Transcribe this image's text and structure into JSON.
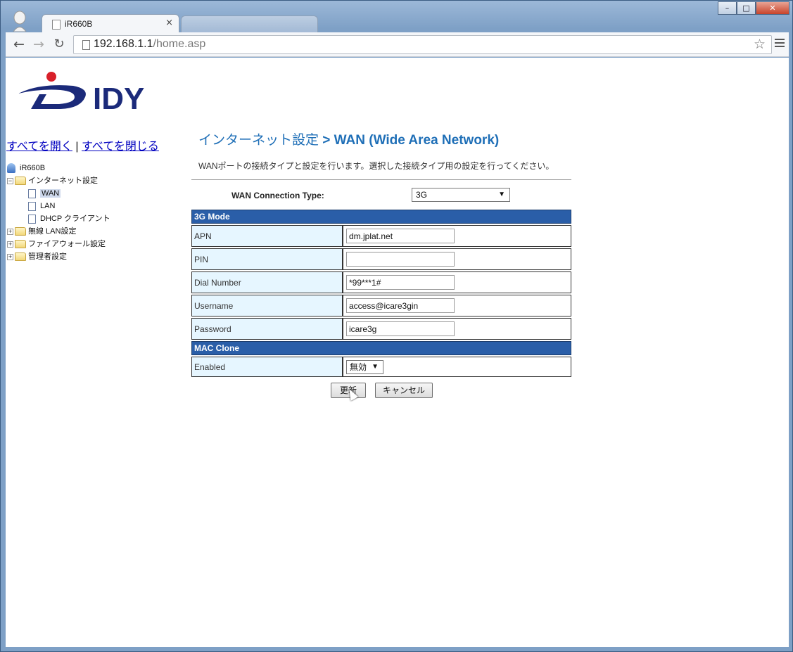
{
  "browser": {
    "tab_title": "iR660B",
    "tab_close": "×",
    "url_host": "192.168.1.1",
    "url_path": "/home.asp",
    "window_buttons": [
      "–",
      "□",
      "✕"
    ]
  },
  "tree": {
    "expand_all": "すべてを開く",
    "separator": "|",
    "collapse_all": "すべてを閉じる",
    "root": "iR660B",
    "items": [
      {
        "label": "インターネット設定",
        "expanded": true
      },
      {
        "label": "WAN",
        "selected": true
      },
      {
        "label": "LAN"
      },
      {
        "label": "DHCP クライアント"
      },
      {
        "label": "無線 LAN設定",
        "expanded": false
      },
      {
        "label": "ファイアウォール設定",
        "expanded": false
      },
      {
        "label": "管理者設定",
        "expanded": false
      }
    ]
  },
  "main": {
    "title_prefix": "インターネット設定",
    "title_suffix": " > WAN (Wide Area Network)",
    "description": "WANポートの接続タイプと設定を行います。選択した接続タイプ用の設定を行ってください。",
    "connection_type_label": "WAN Connection Type:",
    "connection_type_value": "3G",
    "sections": {
      "mode": "3G Mode",
      "mac": "MAC Clone"
    },
    "fields": {
      "apn": {
        "label": "APN",
        "value": "dm.jplat.net"
      },
      "pin": {
        "label": "PIN",
        "value": ""
      },
      "dial": {
        "label": "Dial Number",
        "value": "*99***1#"
      },
      "username": {
        "label": "Username",
        "value": "access@icare3gin"
      },
      "password": {
        "label": "Password",
        "value": "icare3g"
      },
      "enabled": {
        "label": "Enabled",
        "value": "無効"
      }
    },
    "apply_button": "更新",
    "cancel_button": "キャンセル"
  },
  "colors": {
    "section_bg": "#2a5ea8",
    "label_bg": "#e6f6ff",
    "title": "#1f6fb7",
    "logo": "#1b2a7a"
  }
}
